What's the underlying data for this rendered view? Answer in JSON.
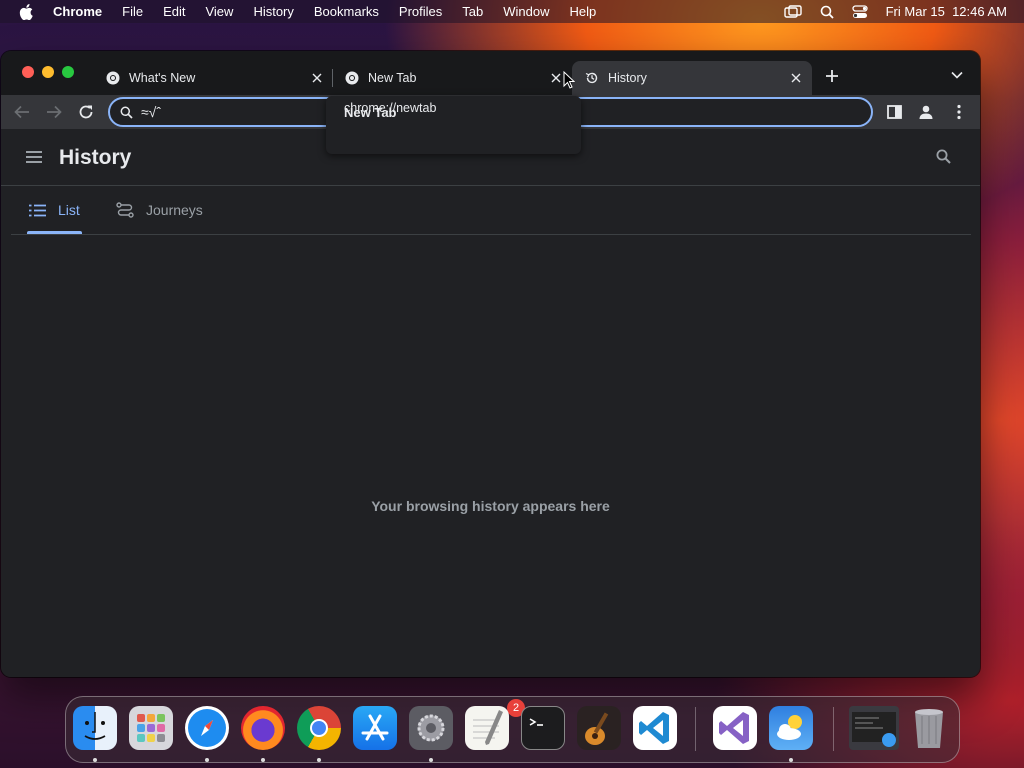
{
  "menubar": {
    "app_name": "Chrome",
    "menus": [
      "File",
      "Edit",
      "View",
      "History",
      "Bookmarks",
      "Profiles",
      "Tab",
      "Window",
      "Help"
    ],
    "clock": "Fri Mar 15  12:46 AM"
  },
  "tabs": [
    {
      "title": "What's New",
      "icon": "chrome-icon"
    },
    {
      "title": "New Tab",
      "icon": "chrome-icon"
    },
    {
      "title": "History",
      "icon": "history-icon",
      "active": true
    }
  ],
  "omnibox": {
    "value": "≈√ˆ"
  },
  "tooltip": {
    "title": "New Tab",
    "url": "chrome://newtab"
  },
  "page": {
    "title": "History",
    "tabs": [
      {
        "label": "List",
        "selected": true
      },
      {
        "label": "Journeys",
        "selected": false
      }
    ],
    "empty_message": "Your browsing history appears here"
  },
  "dock": {
    "apps": [
      "Finder",
      "Launchpad",
      "Safari",
      "Firefox",
      "Chrome",
      "App Store",
      "System Preferences",
      "TextEdit",
      "Terminal",
      "GarageBand",
      "Visual Studio Code",
      "Visual Studio",
      "Weather",
      "Screenshot",
      "Trash"
    ],
    "system_preferences_badge": "2"
  },
  "colors": {
    "accent": "#8ab4f8",
    "window_bg": "#202124",
    "toolbar_bg": "#35363a"
  }
}
